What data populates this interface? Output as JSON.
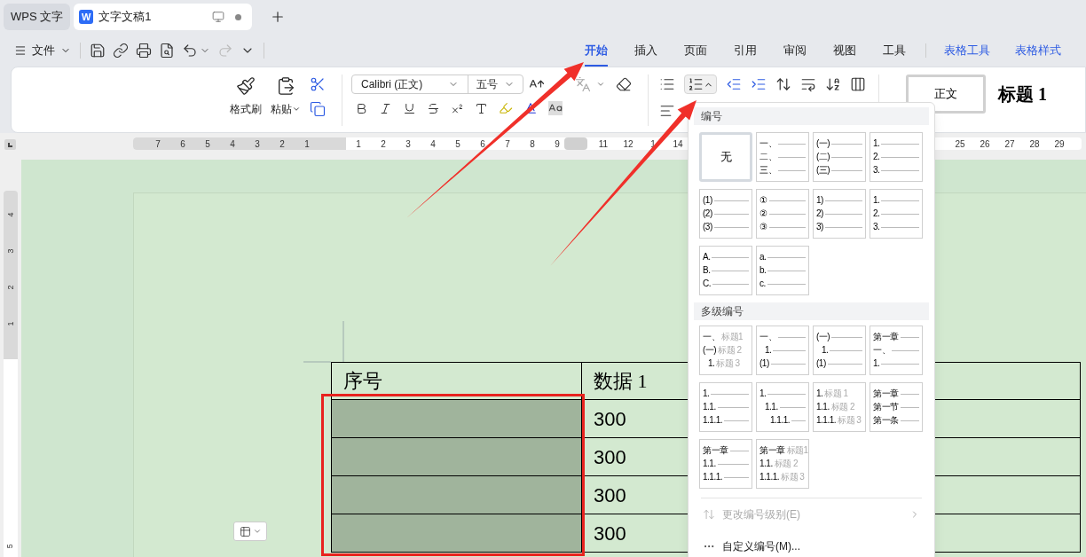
{
  "app_tab": {
    "label": "WPS 文字"
  },
  "doc_tab": {
    "logo": "W",
    "title": "文字文稿1"
  },
  "file_menu": {
    "label": "文件"
  },
  "ribbon_tabs": [
    {
      "label": "开始",
      "selected": true,
      "kind": "main"
    },
    {
      "label": "插入",
      "selected": false,
      "kind": "main"
    },
    {
      "label": "页面",
      "selected": false,
      "kind": "main"
    },
    {
      "label": "引用",
      "selected": false,
      "kind": "main"
    },
    {
      "label": "审阅",
      "selected": false,
      "kind": "main"
    },
    {
      "label": "视图",
      "selected": false,
      "kind": "main"
    },
    {
      "label": "工具",
      "selected": false,
      "kind": "main"
    },
    {
      "label": "表格工具",
      "selected": false,
      "kind": "context"
    },
    {
      "label": "表格样式",
      "selected": false,
      "kind": "context"
    }
  ],
  "ribbon": {
    "format_painter": "格式刷",
    "paste": "粘贴",
    "font_name": "Calibri (正文)",
    "font_size": "五号",
    "numbering_open": true,
    "styles": [
      {
        "label": "正文",
        "selected": true
      },
      {
        "label": "标题 1",
        "selected": false
      }
    ]
  },
  "ruler": {
    "left_numbers": [
      "7",
      "6",
      "5",
      "4",
      "3",
      "2",
      "1"
    ],
    "numbers": [
      "1",
      "2",
      "3",
      "4",
      "5",
      "6",
      "7",
      "8",
      "9"
    ],
    "after_numbers": [
      "11",
      "12",
      "1",
      "14"
    ],
    "far_numbers": [
      "25",
      "26",
      "27",
      "28",
      "29"
    ]
  },
  "vertical_ruler": {
    "numbers": [
      "4",
      "3",
      "2",
      "1"
    ],
    "bottom_number": "5"
  },
  "table": {
    "columns": [
      "序号",
      "数据 1"
    ],
    "rows": [
      {
        "first_cell_selected": true,
        "value": "300"
      },
      {
        "first_cell_selected": true,
        "value": "300"
      },
      {
        "first_cell_selected": true,
        "value": "300"
      },
      {
        "first_cell_selected": true,
        "value": "300"
      }
    ]
  },
  "numbering_panel": {
    "title": "编号",
    "presets": [
      {
        "kind": "none",
        "label": "无",
        "selected": true
      },
      {
        "kind": "list",
        "selected": false,
        "lines": [
          {
            "label": "一、"
          },
          {
            "label": "二、"
          },
          {
            "label": "三、"
          }
        ]
      },
      {
        "kind": "list",
        "selected": false,
        "lines": [
          {
            "label": "(一)"
          },
          {
            "label": "(二)"
          },
          {
            "label": "(三)"
          }
        ]
      },
      {
        "kind": "list",
        "selected": false,
        "lines": [
          {
            "label": "1."
          },
          {
            "label": "2."
          },
          {
            "label": "3."
          }
        ]
      },
      {
        "kind": "list",
        "selected": false,
        "lines": [
          {
            "label": "(1)"
          },
          {
            "label": "(2)"
          },
          {
            "label": "(3)"
          }
        ]
      },
      {
        "kind": "list",
        "selected": false,
        "lines": [
          {
            "label": "①"
          },
          {
            "label": "②"
          },
          {
            "label": "③"
          }
        ]
      },
      {
        "kind": "list",
        "selected": false,
        "lines": [
          {
            "label": "1)"
          },
          {
            "label": "2)"
          },
          {
            "label": "3)"
          }
        ]
      },
      {
        "kind": "list",
        "selected": false,
        "lines": [
          {
            "label": "1."
          },
          {
            "label": "2."
          },
          {
            "label": "3."
          }
        ]
      },
      {
        "kind": "list",
        "selected": false,
        "lines": [
          {
            "label": "A."
          },
          {
            "label": "B."
          },
          {
            "label": "C."
          }
        ]
      },
      {
        "kind": "list",
        "selected": false,
        "lines": [
          {
            "label": "a."
          },
          {
            "label": "b."
          },
          {
            "label": "c."
          }
        ]
      }
    ],
    "multilevel_title": "多级编号",
    "multilevel_presets": [
      {
        "kind": "list",
        "selected": false,
        "lines": [
          {
            "label": "一、",
            "caption": "标题1"
          },
          {
            "label": "(一)",
            "caption": "标题 2",
            "children": [
              {
                "label": "1.",
                "caption": "标题 3"
              }
            ]
          }
        ]
      },
      {
        "kind": "list",
        "selected": false,
        "lines": [
          {
            "label": "一、",
            "children": [
              {
                "label": "1."
              }
            ]
          },
          {
            "label": "(1)"
          }
        ]
      },
      {
        "kind": "list",
        "selected": false,
        "lines": [
          {
            "label": "(一)",
            "children": [
              {
                "label": "1."
              }
            ]
          },
          {
            "label": "(1)"
          }
        ]
      },
      {
        "kind": "list",
        "selected": false,
        "lines": [
          {
            "label": "第一章"
          },
          {
            "label": "一、"
          },
          {
            "label": "1."
          }
        ]
      },
      {
        "kind": "list",
        "selected": false,
        "lines": [
          {
            "label": "1."
          },
          {
            "label": "1.1."
          },
          {
            "label": "1.1.1."
          }
        ]
      },
      {
        "kind": "list",
        "selected": false,
        "lines": [
          {
            "label": "1.",
            "children": [
              {
                "label": "1.1.",
                "children": [
                  {
                    "label": "1.1.1."
                  }
                ]
              }
            ]
          }
        ]
      },
      {
        "kind": "list",
        "selected": false,
        "lines": [
          {
            "label": "1.",
            "caption": "标题 1"
          },
          {
            "label": "1.1.",
            "caption": "标题 2"
          },
          {
            "label": "1.1.1.",
            "caption": "标题 3"
          }
        ]
      },
      {
        "kind": "list",
        "selected": false,
        "lines": [
          {
            "label": "第一章"
          },
          {
            "label": "第一节"
          },
          {
            "label": "第一条"
          }
        ]
      },
      {
        "kind": "list",
        "selected": false,
        "lines": [
          {
            "label": "第一章"
          },
          {
            "label": "1.1."
          },
          {
            "label": "1.1.1."
          }
        ]
      },
      {
        "kind": "list",
        "selected": false,
        "lines": [
          {
            "label": "第一章",
            "caption": "标题1"
          },
          {
            "label": "1.1.",
            "caption": "标题 2"
          },
          {
            "label": "1.1.1.",
            "caption": "标题 3"
          }
        ]
      }
    ],
    "menu": [
      {
        "label": "更改编号级别(E)",
        "disabled": true,
        "submenu": true
      },
      {
        "label": "自定义编号(M)...",
        "disabled": false,
        "submenu": false
      }
    ]
  }
}
